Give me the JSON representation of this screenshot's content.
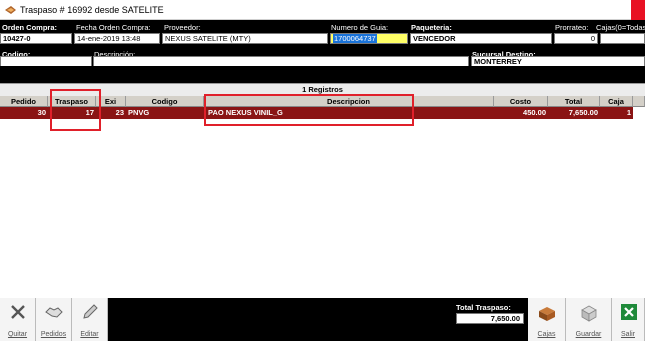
{
  "window": {
    "title": "Traspaso # 16992 desde SATELITE"
  },
  "header": {
    "orden_compra_label": "Orden Compra:",
    "orden_compra_value": "10427-0",
    "fecha_label": "Fecha Orden Compra:",
    "fecha_value": "14-ene-2019 13:48",
    "proveedor_label": "Proveedor:",
    "proveedor_value": "NEXUS SATELITE (MTY)",
    "guia_label": "Numero de Guia:",
    "guia_value": "1700064737",
    "paqueteria_label": "Paqueteria:",
    "paqueteria_value": "VENCEDOR",
    "prorrateo_label": "Prorrateo:",
    "prorrateo_value": "0",
    "cajas_label": "Cajas(0=Todas",
    "codigo_label": "Codigo:",
    "codigo_value": "",
    "descripcion_label": "Descripción:",
    "descripcion_value": "",
    "sucursal_label": "Sucursal Destino:",
    "sucursal_value": "MONTERREY"
  },
  "grid": {
    "count_label": "1 Registros",
    "columns": [
      "Pedido",
      "Traspaso",
      "Exi",
      "Codigo",
      "Descripcion",
      "Costo",
      "Total",
      "Caja"
    ],
    "rows": [
      {
        "pedido": "30",
        "traspaso": "17",
        "exi": "23",
        "codigo": "PNVG",
        "descripcion": "PAO NEXUS VINIL_G",
        "costo": "450.00",
        "total": "7,650.00",
        "caja": "1"
      }
    ]
  },
  "toolbar": {
    "quitar": "Quitar",
    "pedidos": "Pedidos",
    "editar": "Editar",
    "total_label": "Total Traspaso:",
    "total_value": "7,650.00",
    "cajas": "Cajas",
    "guardar": "Guardar",
    "salir": "Salir"
  },
  "colors": {
    "header_bg": "#000000",
    "row_selected": "#8a1414",
    "highlight_field": "#ffff66",
    "annotation": "#e0202a"
  }
}
